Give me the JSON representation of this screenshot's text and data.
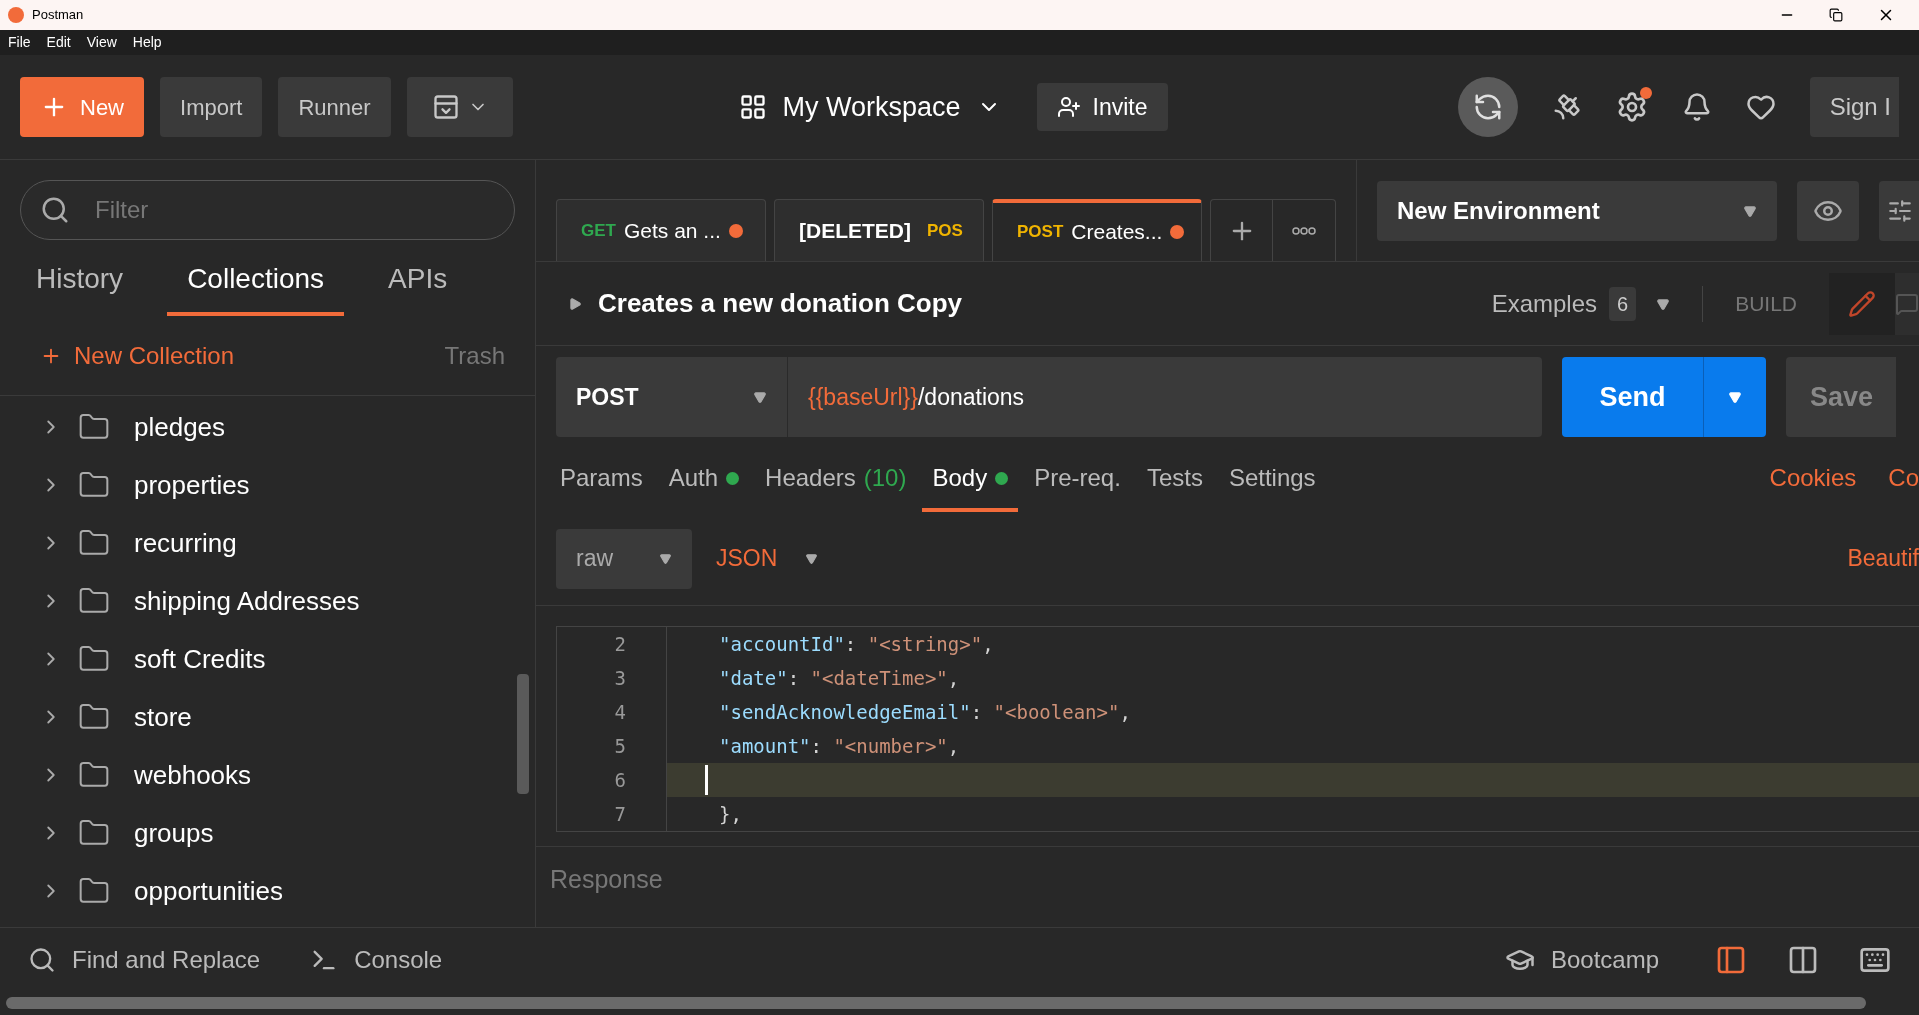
{
  "window": {
    "title": "Postman"
  },
  "menu": [
    "File",
    "Edit",
    "View",
    "Help"
  ],
  "header": {
    "new_button": "New",
    "import_button": "Import",
    "runner_button": "Runner",
    "workspace": "My Workspace",
    "invite_button": "Invite",
    "settings_badge": true,
    "sign_in": "Sign I"
  },
  "sidebar": {
    "filter_placeholder": "Filter",
    "tabs": [
      {
        "label": "History",
        "selected": false
      },
      {
        "label": "Collections",
        "selected": true
      },
      {
        "label": "APIs",
        "selected": false
      }
    ],
    "new_collection": "New Collection",
    "trash": "Trash",
    "folders": [
      "pledges",
      "properties",
      "recurring",
      "shipping Addresses",
      "soft Credits",
      "store",
      "webhooks",
      "groups",
      "opportunities"
    ]
  },
  "request_tabs": [
    {
      "kind": "normal",
      "method": "GET",
      "color": "#2fa84f",
      "label": "Gets an ...",
      "unsaved": true,
      "selected": false
    },
    {
      "kind": "deleted",
      "method": "POS",
      "color": "#f0b400",
      "label": "[DELETED]",
      "unsaved": false,
      "selected": false
    },
    {
      "kind": "normal",
      "method": "POST",
      "color": "#f0b400",
      "label": "Creates...",
      "unsaved": true,
      "selected": true
    }
  ],
  "environment": "New Environment",
  "request": {
    "title": "Creates a new donation Copy",
    "examples": "Examples",
    "examples_count": "6",
    "build": "BUILD",
    "method": "POST",
    "url_variable": "{{baseUrl}}",
    "url_path": "/donations",
    "send": "Send",
    "save": "Save"
  },
  "option_tabs": [
    {
      "label": "Params",
      "dot": false,
      "selected": false
    },
    {
      "label": "Auth",
      "dot": true,
      "selected": false
    },
    {
      "label": "Headers",
      "count": "(10)",
      "dot": false,
      "selected": false
    },
    {
      "label": "Body",
      "dot": true,
      "selected": true
    },
    {
      "label": "Pre-req.",
      "dot": false,
      "selected": false
    },
    {
      "label": "Tests",
      "dot": false,
      "selected": false
    },
    {
      "label": "Settings",
      "dot": false,
      "selected": false
    }
  ],
  "links": [
    "Cookies",
    "Co"
  ],
  "body": {
    "mode": "raw",
    "format": "JSON",
    "beautify": "Beautif"
  },
  "editor": [
    {
      "number": "2",
      "current": false,
      "tokens": [
        {
          "kind": "key",
          "text": "\"accountId\""
        },
        {
          "kind": "punct",
          "text": ": "
        },
        {
          "kind": "string",
          "text": "\"<string>\""
        },
        {
          "kind": "punct",
          "text": ","
        }
      ]
    },
    {
      "number": "3",
      "current": false,
      "tokens": [
        {
          "kind": "key",
          "text": "\"date\""
        },
        {
          "kind": "punct",
          "text": ": "
        },
        {
          "kind": "string",
          "text": "\"<dateTime>\""
        },
        {
          "kind": "punct",
          "text": ","
        }
      ]
    },
    {
      "number": "4",
      "current": false,
      "tokens": [
        {
          "kind": "key",
          "text": "\"sendAcknowledgeEmail\""
        },
        {
          "kind": "punct",
          "text": ": "
        },
        {
          "kind": "string",
          "text": "\"<boolean>\""
        },
        {
          "kind": "punct",
          "text": ","
        }
      ]
    },
    {
      "number": "5",
      "current": false,
      "tokens": [
        {
          "kind": "key",
          "text": "\"amount\""
        },
        {
          "kind": "punct",
          "text": ": "
        },
        {
          "kind": "string",
          "text": "\"<number>\""
        },
        {
          "kind": "punct",
          "text": ","
        }
      ]
    },
    {
      "number": "6",
      "current": true
    },
    {
      "number": "7",
      "current": false,
      "tokens": [
        {
          "kind": "punct",
          "text": "},"
        }
      ]
    }
  ],
  "response_label": "Response",
  "footer": {
    "find_replace": "Find and Replace",
    "console": "Console",
    "bootcamp": "Bootcamp"
  }
}
